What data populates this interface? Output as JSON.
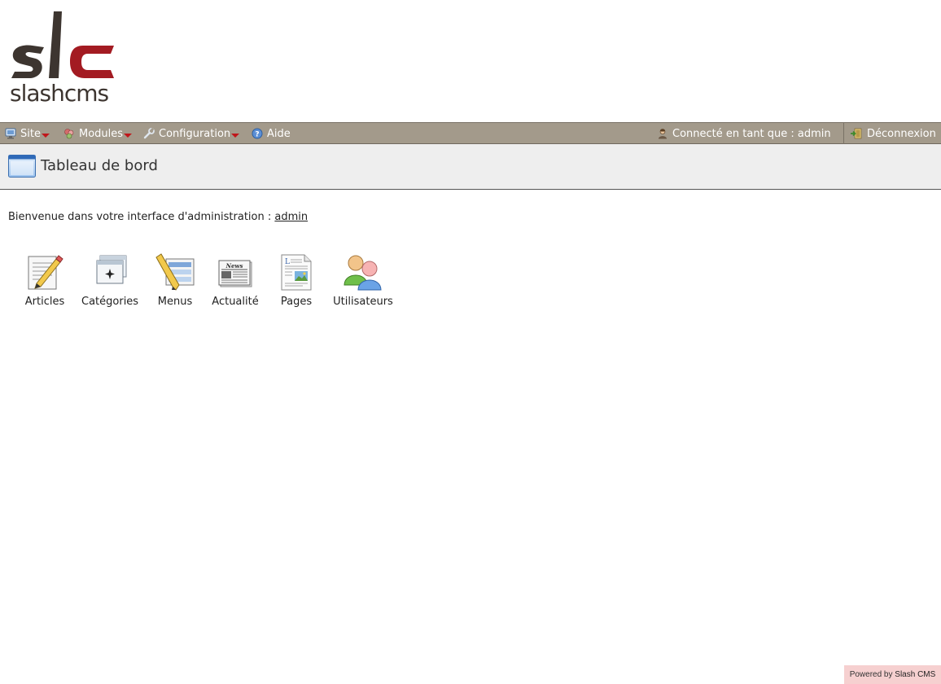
{
  "logo": {
    "text": "slashcms",
    "alt": "slc"
  },
  "menubar": {
    "items": [
      {
        "label": "Site",
        "icon": "monitor-icon",
        "has_dropdown": true
      },
      {
        "label": "Modules",
        "icon": "modules-icon",
        "has_dropdown": true
      },
      {
        "label": "Configuration",
        "icon": "wrench-icon",
        "has_dropdown": true
      },
      {
        "label": "Aide",
        "icon": "help-icon",
        "has_dropdown": false
      }
    ],
    "user_status": "Connecté en tant que : admin",
    "logout_label": "Déconnexion"
  },
  "page": {
    "title": "Tableau de bord"
  },
  "welcome": {
    "text": "Bienvenue dans votre interface d'administration : ",
    "user": "admin"
  },
  "shortcuts": [
    {
      "label": "Articles",
      "icon": "article-pencil-icon"
    },
    {
      "label": "Catégories",
      "icon": "categories-window-icon"
    },
    {
      "label": "Menus",
      "icon": "menus-icon"
    },
    {
      "label": "Actualité",
      "icon": "newspaper-icon"
    },
    {
      "label": "Pages",
      "icon": "page-icon"
    },
    {
      "label": "Utilisateurs",
      "icon": "users-icon"
    }
  ],
  "footer": {
    "prefix": "Powered by ",
    "brand": "Slash CMS"
  },
  "colors": {
    "menubar": "#a39a8b",
    "accent_red": "#a31b22",
    "logo_dark": "#3d3530",
    "title_bg": "#eeeeee",
    "footer_bg": "#f6d0d0"
  }
}
